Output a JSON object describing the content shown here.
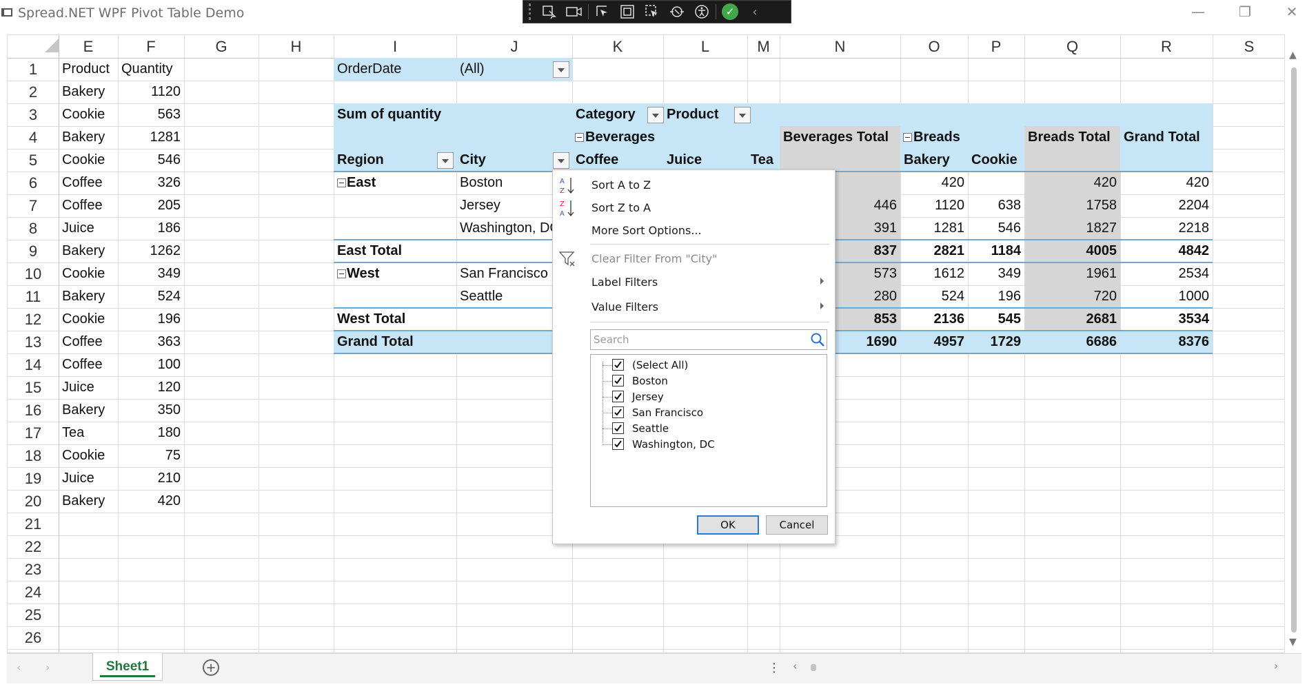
{
  "window": {
    "title": "Spread.NET WPF Pivot Table Demo",
    "minimize": "—",
    "restore": "❐",
    "close": "✕"
  },
  "debug_toolbar": {
    "icons": [
      "select-element-icon",
      "video-icon",
      "pointer-select-icon",
      "layout-adorner-icon",
      "track-focus-icon",
      "binding-failures-icon",
      "accessibility-icon",
      "checkmark-icon",
      "collapse-icon"
    ]
  },
  "columns": [
    "E",
    "F",
    "G",
    "H",
    "I",
    "J",
    "K",
    "L",
    "M",
    "N",
    "O",
    "P",
    "Q",
    "R",
    "S"
  ],
  "rows": [
    "1",
    "2",
    "3",
    "4",
    "5",
    "6",
    "7",
    "8",
    "9",
    "10",
    "11",
    "12",
    "13",
    "14",
    "15",
    "16",
    "17",
    "18",
    "19",
    "20",
    "21",
    "22",
    "23",
    "24",
    "25",
    "26"
  ],
  "source_table": {
    "headers": [
      "Product",
      "Quantity"
    ],
    "rows": [
      [
        "Bakery",
        "1120"
      ],
      [
        "Cookie",
        "563"
      ],
      [
        "Bakery",
        "1281"
      ],
      [
        "Cookie",
        "546"
      ],
      [
        "Coffee",
        "326"
      ],
      [
        "Coffee",
        "205"
      ],
      [
        "Juice",
        "186"
      ],
      [
        "Bakery",
        "1262"
      ],
      [
        "Cookie",
        "349"
      ],
      [
        "Bakery",
        "524"
      ],
      [
        "Cookie",
        "196"
      ],
      [
        "Coffee",
        "363"
      ],
      [
        "Coffee",
        "100"
      ],
      [
        "Juice",
        "120"
      ],
      [
        "Bakery",
        "350"
      ],
      [
        "Tea",
        "180"
      ],
      [
        "Cookie",
        "75"
      ],
      [
        "Juice",
        "210"
      ],
      [
        "Bakery",
        "420"
      ]
    ]
  },
  "pivot": {
    "filter_label": "OrderDate",
    "filter_value": "(All)",
    "data_label": "Sum of quantity",
    "col_field_1": "Category",
    "col_field_2": "Product",
    "beverages": "Beverages",
    "beverages_total": "Beverages Total",
    "breads": "Breads",
    "breads_total": "Breads Total",
    "grand_total_header": "Grand Total",
    "region_label": "Region",
    "city_label": "City",
    "prod_coffee": "Coffee",
    "prod_juice": "Juice",
    "prod_tea": "Tea",
    "prod_bakery": "Bakery",
    "prod_cookie": "Cookie",
    "rows": [
      {
        "region": "East",
        "city": "Boston",
        "bev_total": "",
        "bakery": "420",
        "cookie": "",
        "breads_total": "420",
        "grand": "420"
      },
      {
        "region": "",
        "city": "Jersey",
        "bev_total": "446",
        "bakery": "1120",
        "cookie": "638",
        "breads_total": "1758",
        "grand": "2204"
      },
      {
        "region": "",
        "city": "Washington, DC",
        "bev_total": "391",
        "bakery": "1281",
        "cookie": "546",
        "breads_total": "1827",
        "grand": "2218"
      },
      {
        "region": "East Total",
        "city": "",
        "bev_total": "837",
        "bakery": "2821",
        "cookie": "1184",
        "breads_total": "4005",
        "grand": "4842"
      },
      {
        "region": "West",
        "city": "San Francisco",
        "bev_total": "573",
        "bakery": "1612",
        "cookie": "349",
        "breads_total": "1961",
        "grand": "2534"
      },
      {
        "region": "",
        "city": "Seattle",
        "bev_total": "280",
        "bakery": "524",
        "cookie": "196",
        "breads_total": "720",
        "grand": "1000"
      },
      {
        "region": "West Total",
        "city": "",
        "bev_total": "853",
        "bakery": "2136",
        "cookie": "545",
        "breads_total": "2681",
        "grand": "3534"
      },
      {
        "region": "Grand Total",
        "city": "",
        "bev_total": "1690",
        "bakery": "4957",
        "cookie": "1729",
        "breads_total": "6686",
        "grand": "8376"
      }
    ]
  },
  "filter_popup": {
    "sort_az": "Sort A to Z",
    "sort_za": "Sort Z to A",
    "more_sort": "More Sort Options...",
    "clear_filter": "Clear Filter From \"City\"",
    "label_filters": "Label Filters",
    "value_filters": "Value Filters",
    "search_placeholder": "Search",
    "items": [
      "(Select All)",
      "Boston",
      "Jersey",
      "San Francisco",
      "Seattle",
      "Washington, DC"
    ],
    "ok": "OK",
    "cancel": "Cancel"
  },
  "sheet": {
    "tab_name": "Sheet1",
    "add_sheet": "+"
  },
  "colors": {
    "pivot_blue": "#c6e5f6",
    "pivot_gray": "#d6d6d6",
    "sheet_tab_green": "#1e7a3a"
  }
}
